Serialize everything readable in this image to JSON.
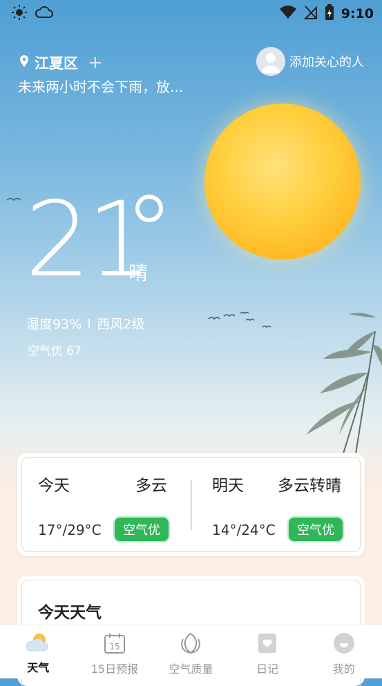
{
  "status": {
    "time": "9:10"
  },
  "location": {
    "name": "江夏区",
    "plus": "+"
  },
  "forecast_line": "未来两小时不会下雨，放...",
  "add_care": {
    "label": "添加关心的人"
  },
  "current": {
    "temperature": "21",
    "condition": "晴",
    "humidity": "湿度93%",
    "wind": "西风2级",
    "aqi": "空气优 67"
  },
  "days": [
    {
      "name": "今天",
      "condition": "多云",
      "temp": "17°/29°C",
      "aqi": "空气优"
    },
    {
      "name": "明天",
      "condition": "多云转晴",
      "temp": "14°/24°C",
      "aqi": "空气优"
    }
  ],
  "today_card": {
    "title": "今天天气"
  },
  "nav": [
    {
      "label": "天气",
      "icon": "weather-icon",
      "active": true
    },
    {
      "label": "15日预报",
      "icon": "calendar-15-icon",
      "active": false
    },
    {
      "label": "空气质量",
      "icon": "leaf-icon",
      "active": false
    },
    {
      "label": "日记",
      "icon": "diary-icon",
      "active": false
    },
    {
      "label": "我的",
      "icon": "profile-icon",
      "active": false
    }
  ],
  "colors": {
    "aqi_green": "#2fb75a",
    "sun": "#ffc12e"
  }
}
